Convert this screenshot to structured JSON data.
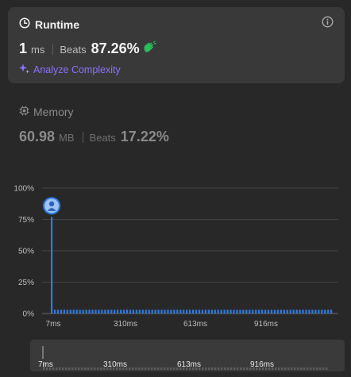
{
  "runtime": {
    "title": "Runtime",
    "value": "1",
    "unit": "ms",
    "beats_label": "Beats",
    "beats_value": "87.26%",
    "analyze_label": "Analyze Complexity"
  },
  "memory": {
    "title": "Memory",
    "value": "60.98",
    "unit": "MB",
    "beats_label": "Beats",
    "beats_value": "17.22%"
  },
  "colors": {
    "accent": "#8e72ff",
    "bar": "#2b7de9",
    "beats_icon": "#2cbb5d"
  },
  "chart_data": {
    "type": "bar",
    "ylabel": "",
    "xlabel": "",
    "y_ticks": [
      "100%",
      "75%",
      "50%",
      "25%",
      "0%"
    ],
    "ylim": [
      0,
      100
    ],
    "x_ticks": [
      "7ms",
      "310ms",
      "613ms",
      "916ms"
    ],
    "series": [
      {
        "values": [
          77,
          3,
          3,
          3,
          3,
          3,
          3,
          3,
          3,
          3,
          3,
          3,
          3,
          3,
          3,
          3,
          3,
          3,
          3,
          3,
          3,
          3,
          3,
          3,
          3,
          3,
          3,
          3,
          3,
          3,
          3,
          3,
          3,
          3,
          3,
          3,
          3,
          3,
          3,
          3,
          3,
          3,
          3,
          3,
          3,
          3,
          3,
          3,
          3,
          3,
          3,
          3,
          3,
          3,
          3,
          3,
          3,
          3,
          3,
          3,
          3,
          3,
          3,
          3,
          3,
          3,
          3,
          3,
          3,
          3,
          3,
          3,
          3,
          3,
          3,
          3,
          3,
          3,
          3,
          3,
          3,
          3,
          3,
          3,
          3,
          3,
          3,
          3,
          3,
          3
        ]
      }
    ],
    "grid": true,
    "marker_on_bar": 0
  },
  "minimap": {
    "labels": [
      "7ms",
      "310ms",
      "613ms",
      "916ms"
    ]
  }
}
